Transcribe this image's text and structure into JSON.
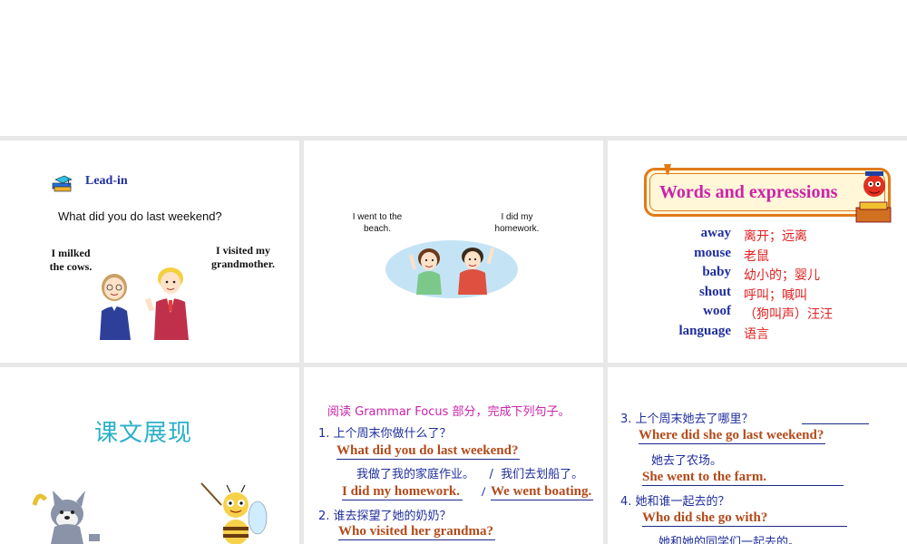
{
  "slide1": {
    "section_label": "Lead-in",
    "question": "What did you do last weekend?",
    "bubble_left": [
      "I milked",
      "the cows."
    ],
    "bubble_right": [
      "I visited my",
      "grandmother."
    ]
  },
  "slide2": {
    "bubble_left": [
      "I went to the",
      "beach."
    ],
    "bubble_right": [
      "I did my",
      "homework."
    ]
  },
  "slide3": {
    "banner_title": "Words and expressions",
    "vocab": [
      {
        "en": "away",
        "zh": "离开；远离"
      },
      {
        "en": "mouse",
        "zh": "老鼠"
      },
      {
        "en": "baby",
        "zh": "幼小的；婴儿"
      },
      {
        "en": "shout",
        "zh": "呼叫；喊叫"
      },
      {
        "en": "woof",
        "zh": "（狗叫声）汪汪"
      },
      {
        "en": "language",
        "zh": "语言"
      }
    ]
  },
  "slide4": {
    "title": "课文展现"
  },
  "slide5": {
    "instruction": "阅读 Grammar Focus 部分，完成下列句子。",
    "q1": "1.  上个周末你做什么了？",
    "a1": "What did you do last weekend?",
    "q1_cn": "我做了我的家庭作业。    /  我们去划船了。",
    "a1_part1": "I did my homework.",
    "a1_sep": "/",
    "a1_part2": "We went boating.",
    "q2": "2.  谁去探望了她的奶奶？",
    "a2": "Who visited her grandma?"
  },
  "slide6": {
    "q3": "3.  上个周末她去了哪里？",
    "a3": "Where did she go last weekend?",
    "q3_cn": "她去了农场。",
    "a3_answer": "She went to the farm.",
    "q4": "4.  她和谁一起去的？",
    "a4": "Who did she go with?",
    "q4_cn": "她和她的同学们一起去的。"
  },
  "colors": {
    "accent_blue": "#1f2f9e",
    "answer_red": "#b34a1a",
    "title_cyan": "#2ab0c8",
    "banner_purple": "#cc22aa"
  }
}
